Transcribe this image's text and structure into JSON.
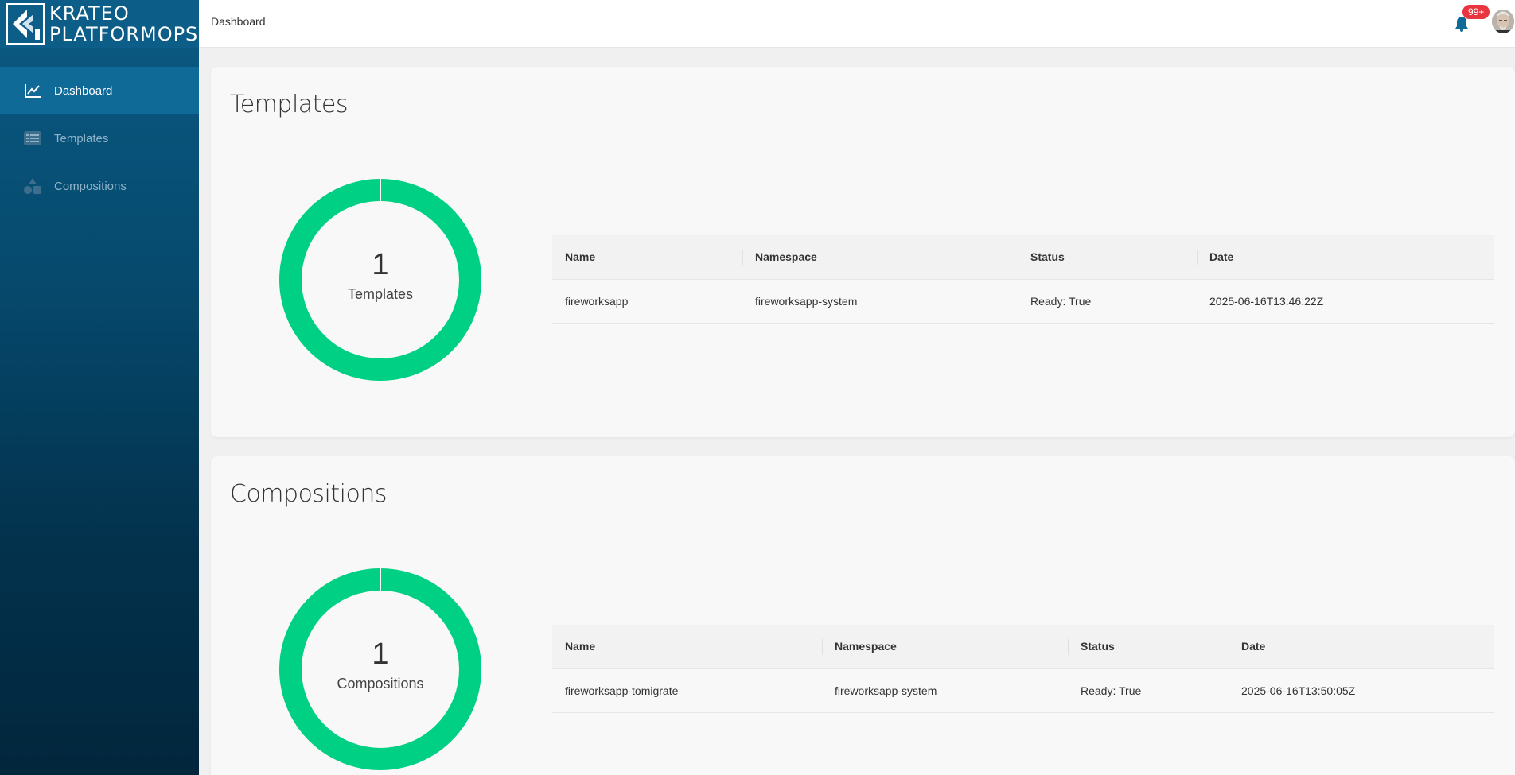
{
  "app": {
    "logo_line1": "KRATEO",
    "logo_line2": "PLATFORMOPS"
  },
  "sidebar": {
    "items": [
      {
        "label": "Dashboard",
        "icon": "chart-line-icon",
        "active": true
      },
      {
        "label": "Templates",
        "icon": "list-icon",
        "active": false
      },
      {
        "label": "Compositions",
        "icon": "shapes-icon",
        "active": false
      }
    ]
  },
  "topbar": {
    "breadcrumb": "Dashboard",
    "notification_count": "99+"
  },
  "templates": {
    "title": "Templates",
    "count": "1",
    "count_label": "Templates",
    "columns": [
      "Name",
      "Namespace",
      "Status",
      "Date"
    ],
    "rows": [
      {
        "name": "fireworksapp",
        "namespace": "fireworksapp-system",
        "status": "Ready: True",
        "date": "2025-06-16T13:46:22Z"
      }
    ]
  },
  "compositions": {
    "title": "Compositions",
    "count": "1",
    "count_label": "Compositions",
    "columns": [
      "Name",
      "Namespace",
      "Status",
      "Date"
    ],
    "rows": [
      {
        "name": "fireworksapp-tomigrate",
        "namespace": "fireworksapp-system",
        "status": "Ready: True",
        "date": "2025-06-16T13:50:05Z"
      }
    ]
  },
  "colors": {
    "donut": "#00d084",
    "sidebar_active": "#0f6a98",
    "badge": "#e8353f"
  }
}
